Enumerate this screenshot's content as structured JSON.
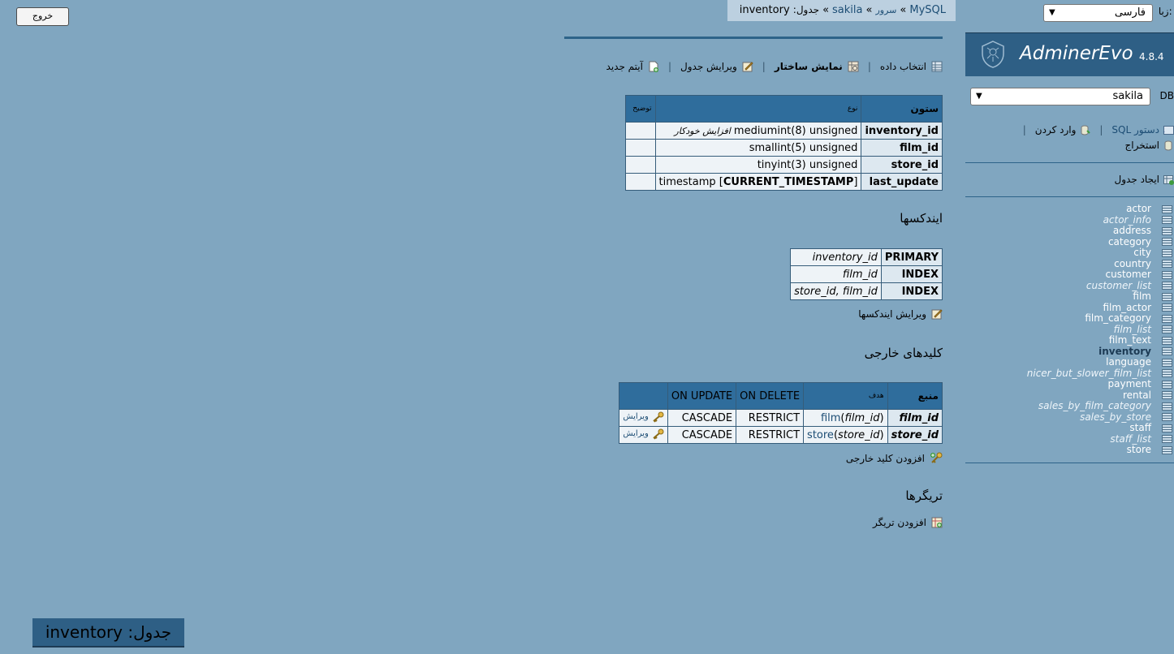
{
  "logout_label": "خروج",
  "breadcrumb": {
    "driver": "MySQL",
    "server": "سرور",
    "database": "sakila",
    "table_prefix": "جدول:",
    "table": "inventory",
    "sep": "»"
  },
  "actions": {
    "select_data": "انتخاب داده",
    "show_structure": "نمایش ساختار",
    "alter_table": "ویرایش جدول",
    "new_item": "آیتم جدید"
  },
  "columns_table": {
    "headers": {
      "column": "ستون",
      "type": "نوع",
      "comment": "توضیح"
    },
    "rows": [
      {
        "name": "inventory_id",
        "type": "mediumint(8) unsigned",
        "extra": "افزایش خودکار"
      },
      {
        "name": "film_id",
        "type": "smallint(5) unsigned",
        "extra": ""
      },
      {
        "name": "store_id",
        "type": "tinyint(3) unsigned",
        "extra": ""
      },
      {
        "name": "last_update",
        "type_prefix": "timestamp [",
        "type_default": "CURRENT_TIMESTAMP",
        "type_suffix": "]"
      }
    ]
  },
  "indexes": {
    "title": "ایندکسها",
    "rows": [
      {
        "type": "PRIMARY",
        "columns": "inventory_id"
      },
      {
        "type": "INDEX",
        "columns": "film_id"
      },
      {
        "type": "INDEX",
        "columns": "store_id, film_id"
      }
    ],
    "edit_label": "ویرایش ایندکسها"
  },
  "foreign_keys": {
    "title": "کلیدهای خارجی",
    "headers": {
      "source": "منبع",
      "target": "هدف",
      "on_delete": "ON DELETE",
      "on_update": "ON UPDATE"
    },
    "rows": [
      {
        "source": "film_id",
        "target_table": "film",
        "target_col": "film_id",
        "on_delete": "RESTRICT",
        "on_update": "CASCADE",
        "edit": "ویرایش"
      },
      {
        "source": "store_id",
        "target_table": "store",
        "target_col": "store_id",
        "on_delete": "RESTRICT",
        "on_update": "CASCADE",
        "edit": "ویرایش"
      }
    ],
    "add_label": "افزودن کلید خارجی"
  },
  "triggers": {
    "title": "تریگرها",
    "add_label": "افزودن تریگر"
  },
  "sidebar": {
    "lang_label": "زبان:",
    "lang_value": "فارسی",
    "app_name": "AdminerEvo",
    "version": "4.8.4",
    "db_label": "DB:",
    "db_value": "sakila",
    "sql_command": "دستور SQL",
    "import": "وارد کردن",
    "export": "استخراج",
    "create_table": "ایجاد جدول",
    "tables": [
      {
        "name": "actor",
        "view": false
      },
      {
        "name": "actor_info",
        "view": true
      },
      {
        "name": "address",
        "view": false
      },
      {
        "name": "category",
        "view": false
      },
      {
        "name": "city",
        "view": false
      },
      {
        "name": "country",
        "view": false
      },
      {
        "name": "customer",
        "view": false
      },
      {
        "name": "customer_list",
        "view": true
      },
      {
        "name": "film",
        "view": false
      },
      {
        "name": "film_actor",
        "view": false
      },
      {
        "name": "film_category",
        "view": false
      },
      {
        "name": "film_list",
        "view": true
      },
      {
        "name": "film_text",
        "view": false
      },
      {
        "name": "inventory",
        "view": false,
        "current": true
      },
      {
        "name": "language",
        "view": false
      },
      {
        "name": "nicer_but_slower_film_list",
        "view": true
      },
      {
        "name": "payment",
        "view": false
      },
      {
        "name": "rental",
        "view": false
      },
      {
        "name": "sales_by_film_category",
        "view": true
      },
      {
        "name": "sales_by_store",
        "view": true
      },
      {
        "name": "staff",
        "view": false
      },
      {
        "name": "staff_list",
        "view": true
      },
      {
        "name": "store",
        "view": false
      }
    ]
  },
  "bottom_title": {
    "prefix": "جدول:",
    "table": "inventory"
  },
  "colors": {
    "background": "#80a6c0",
    "header": "#2f6d9c",
    "link": "#1c4d74"
  }
}
